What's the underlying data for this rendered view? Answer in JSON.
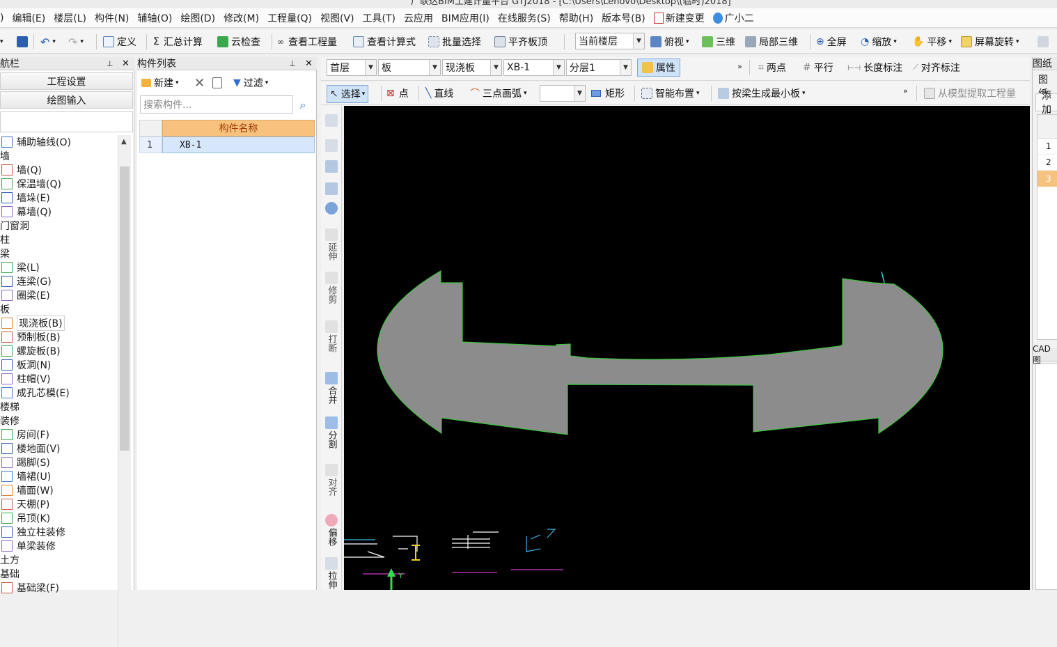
{
  "window": {
    "title_fragment": "广联达BIM土建计量平台 GTJ2018 - [C:\\Users\\Lenovo\\Desktop\\(临时)2018]"
  },
  "menu": {
    "items": [
      "编辑(E)",
      "楼层(L)",
      "构件(N)",
      "辅轴(O)",
      "绘图(D)",
      "修改(M)",
      "工程量(Q)",
      "视图(V)",
      "工具(T)",
      "云应用",
      "BIM应用(I)",
      "在线服务(S)",
      "帮助(H)",
      "版本号(B)",
      "新建变更",
      "广小二"
    ],
    "first_fragment": ")"
  },
  "toolbar1": {
    "define": "定义",
    "summary_calc": "汇总计算",
    "cloud_check": "云检查",
    "view_quantity": "查看工程量",
    "view_formula": "查看计算式",
    "batch_select": "批量选择",
    "align_slab_top": "平齐板顶",
    "current_floor": "当前楼层",
    "top_view": "俯视",
    "three_d": "三维",
    "local_3d": "局部三维",
    "fullscreen": "全屏",
    "zoom": "缩放",
    "pan": "平移",
    "screen_rotate": "屏幕旋转"
  },
  "toolbar2": {
    "floor": "首层",
    "category": "板",
    "type": "现浇板",
    "element": "XB-1",
    "layer": "分层1",
    "properties": "属性",
    "two_points": "两点",
    "parallel": "平行",
    "length_dim": "长度标注",
    "align_dim": "对齐标注"
  },
  "toolbar3": {
    "select": "选择",
    "point": "点",
    "line": "直线",
    "arc": "三点画弧",
    "rect": "矩形",
    "smart_layout": "智能布置",
    "gen_by_beam": "按梁生成最小板",
    "extract_from_model": "从模型提取工程量"
  },
  "nav": {
    "header": "航栏",
    "project_settings": "工程设置",
    "drawing_input": "绘图输入",
    "tree": [
      {
        "label": "辅助轴线(O)",
        "icon": "axis-icon",
        "indent": true
      },
      {
        "label": "墙",
        "group": true
      },
      {
        "label": "墙(Q)",
        "icon": "wall-icon",
        "indent": true
      },
      {
        "label": "保温墙(Q)",
        "icon": "insulation-wall-icon",
        "indent": true
      },
      {
        "label": "墙垛(E)",
        "icon": "wall-pier-icon",
        "indent": true
      },
      {
        "label": "幕墙(Q)",
        "icon": "curtain-wall-icon",
        "indent": true
      },
      {
        "label": "门窗洞",
        "group": true
      },
      {
        "label": "柱",
        "group": true
      },
      {
        "label": "梁",
        "group": true
      },
      {
        "label": "梁(L)",
        "icon": "beam-icon",
        "indent": true
      },
      {
        "label": "连梁(G)",
        "icon": "link-beam-icon",
        "indent": true
      },
      {
        "label": "圈梁(E)",
        "icon": "ring-beam-icon",
        "indent": true
      },
      {
        "label": "板",
        "group": true
      },
      {
        "label": "现浇板(B)",
        "icon": "cast-slab-icon",
        "indent": true,
        "selected": true
      },
      {
        "label": "预制板(B)",
        "icon": "precast-slab-icon",
        "indent": true
      },
      {
        "label": "螺旋板(B)",
        "icon": "spiral-slab-icon",
        "indent": true
      },
      {
        "label": "板洞(N)",
        "icon": "slab-hole-icon",
        "indent": true
      },
      {
        "label": "柱帽(V)",
        "icon": "column-cap-icon",
        "indent": true
      },
      {
        "label": "成孔芯模(E)",
        "icon": "core-mold-icon",
        "indent": true
      },
      {
        "label": "楼梯",
        "group": true
      },
      {
        "label": "装修",
        "group": true
      },
      {
        "label": "房间(F)",
        "icon": "room-icon",
        "indent": true
      },
      {
        "label": "楼地面(V)",
        "icon": "floor-icon",
        "indent": true
      },
      {
        "label": "踢脚(S)",
        "icon": "skirting-icon",
        "indent": true
      },
      {
        "label": "墙裙(U)",
        "icon": "dado-icon",
        "indent": true
      },
      {
        "label": "墙面(W)",
        "icon": "wall-finish-icon",
        "indent": true
      },
      {
        "label": "天棚(P)",
        "icon": "ceiling-icon",
        "indent": true
      },
      {
        "label": "吊顶(K)",
        "icon": "suspended-ceiling-icon",
        "indent": true
      },
      {
        "label": "独立柱装修",
        "icon": "column-finish-icon",
        "indent": true
      },
      {
        "label": "单梁装修",
        "icon": "beam-finish-icon",
        "indent": true
      },
      {
        "label": "土方",
        "group": true
      },
      {
        "label": "基础",
        "group": true
      },
      {
        "label": "基础梁(F)",
        "icon": "foundation-beam-icon",
        "indent": true
      }
    ]
  },
  "complist": {
    "header": "构件列表",
    "new": "新建",
    "filter": "过滤",
    "search_placeholder": "搜索构件...",
    "column_name": "构件名称",
    "rows": [
      {
        "idx": "1",
        "name": "XB-1"
      }
    ]
  },
  "vtools": {
    "extend": "延伸",
    "trim": "修剪",
    "break": "打断",
    "merge": "合并",
    "split": "分割",
    "align": "对齐",
    "offset": "偏移",
    "stretch": "拉伸"
  },
  "right": {
    "header": "图纸",
    "tab": "图纸",
    "add": "添加",
    "rows": [
      "1",
      "2",
      "3"
    ],
    "cad_header": "CAD图"
  },
  "colors": {
    "canvas": "#000000",
    "slab_fill": "#8c8c8c",
    "slab_edge": "#3ec43e",
    "selected_row": "#d6e6fb",
    "header_orange": "#f7c27d"
  }
}
